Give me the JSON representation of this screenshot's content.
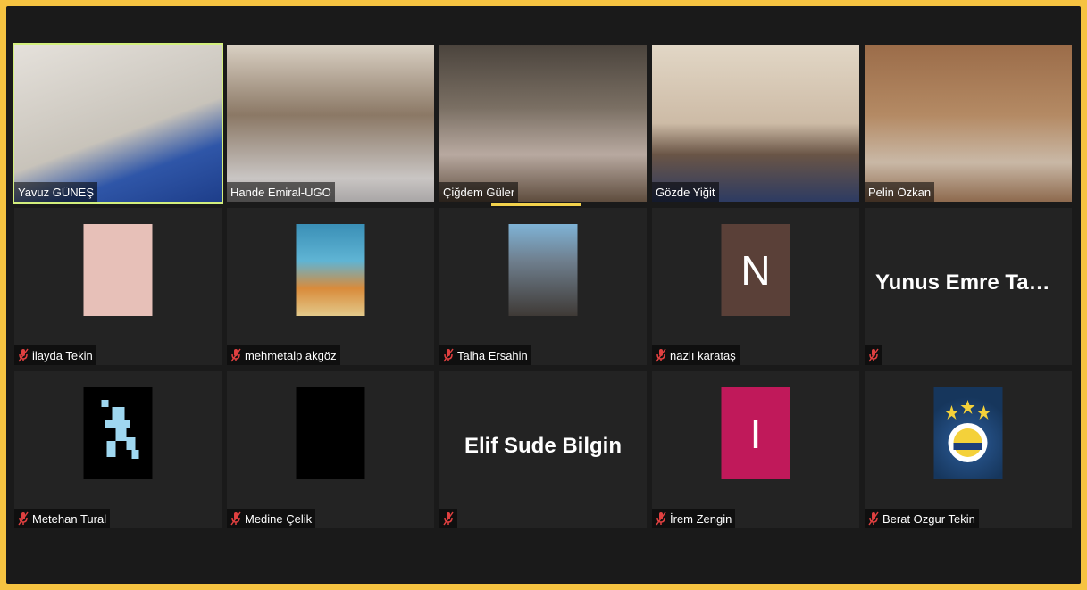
{
  "meeting": {
    "accent_color": "#f6c341",
    "active_speaker_outline": "#d3ef7d",
    "participants_row1": [
      {
        "name": "Yavuz GÜNEŞ",
        "video": "video-feed",
        "bg": "#c9c3b8"
      },
      {
        "name": "Hande Emiral-UGO",
        "video": "video-feed",
        "bg": "#8d7b6a"
      },
      {
        "name": "Çiğdem Güler",
        "video": "video-feed",
        "bg": "#6c6257"
      },
      {
        "name": "Gözde Yiğit",
        "video": "video-feed",
        "bg": "#d2c2aa"
      },
      {
        "name": "Pelin Özkan",
        "video": "video-feed",
        "bg": "#a77b58"
      }
    ],
    "participants_row2": [
      {
        "name": "ilayda Tekin",
        "muted": true,
        "avatar": "anime-avatar",
        "avatar_bg": "#e7c0b8"
      },
      {
        "name": "mehmetalp akgöz",
        "muted": true,
        "avatar": "album-cover-avatar",
        "avatar_bg": "#3a8fb6"
      },
      {
        "name": "Talha Ersahin",
        "muted": true,
        "avatar": "photo-avatar",
        "avatar_bg": "#7a6e64"
      },
      {
        "name": "nazlı karataş",
        "muted": true,
        "avatar": "letter-avatar",
        "letter": "N",
        "avatar_bg": "#5a4038"
      },
      {
        "name": "",
        "muted": true,
        "display_name": "Yunus Emre Taşa..."
      }
    ],
    "participants_row3": [
      {
        "name": "Metehan Tural",
        "muted": true,
        "avatar": "pixel-avatar",
        "avatar_bg": "#000000"
      },
      {
        "name": "Medine Çelik",
        "muted": true,
        "avatar": "black-avatar",
        "avatar_bg": "#000000"
      },
      {
        "name": "",
        "muted": true,
        "display_name": "Elif Sude Bilgin"
      },
      {
        "name": "İrem Zengin",
        "muted": true,
        "avatar": "letter-avatar",
        "letter": "I",
        "avatar_bg": "#c0195a"
      },
      {
        "name": "Berat Ozgur Tekin",
        "muted": true,
        "avatar": "club-logo-avatar",
        "avatar_bg": "#16365c"
      }
    ]
  }
}
